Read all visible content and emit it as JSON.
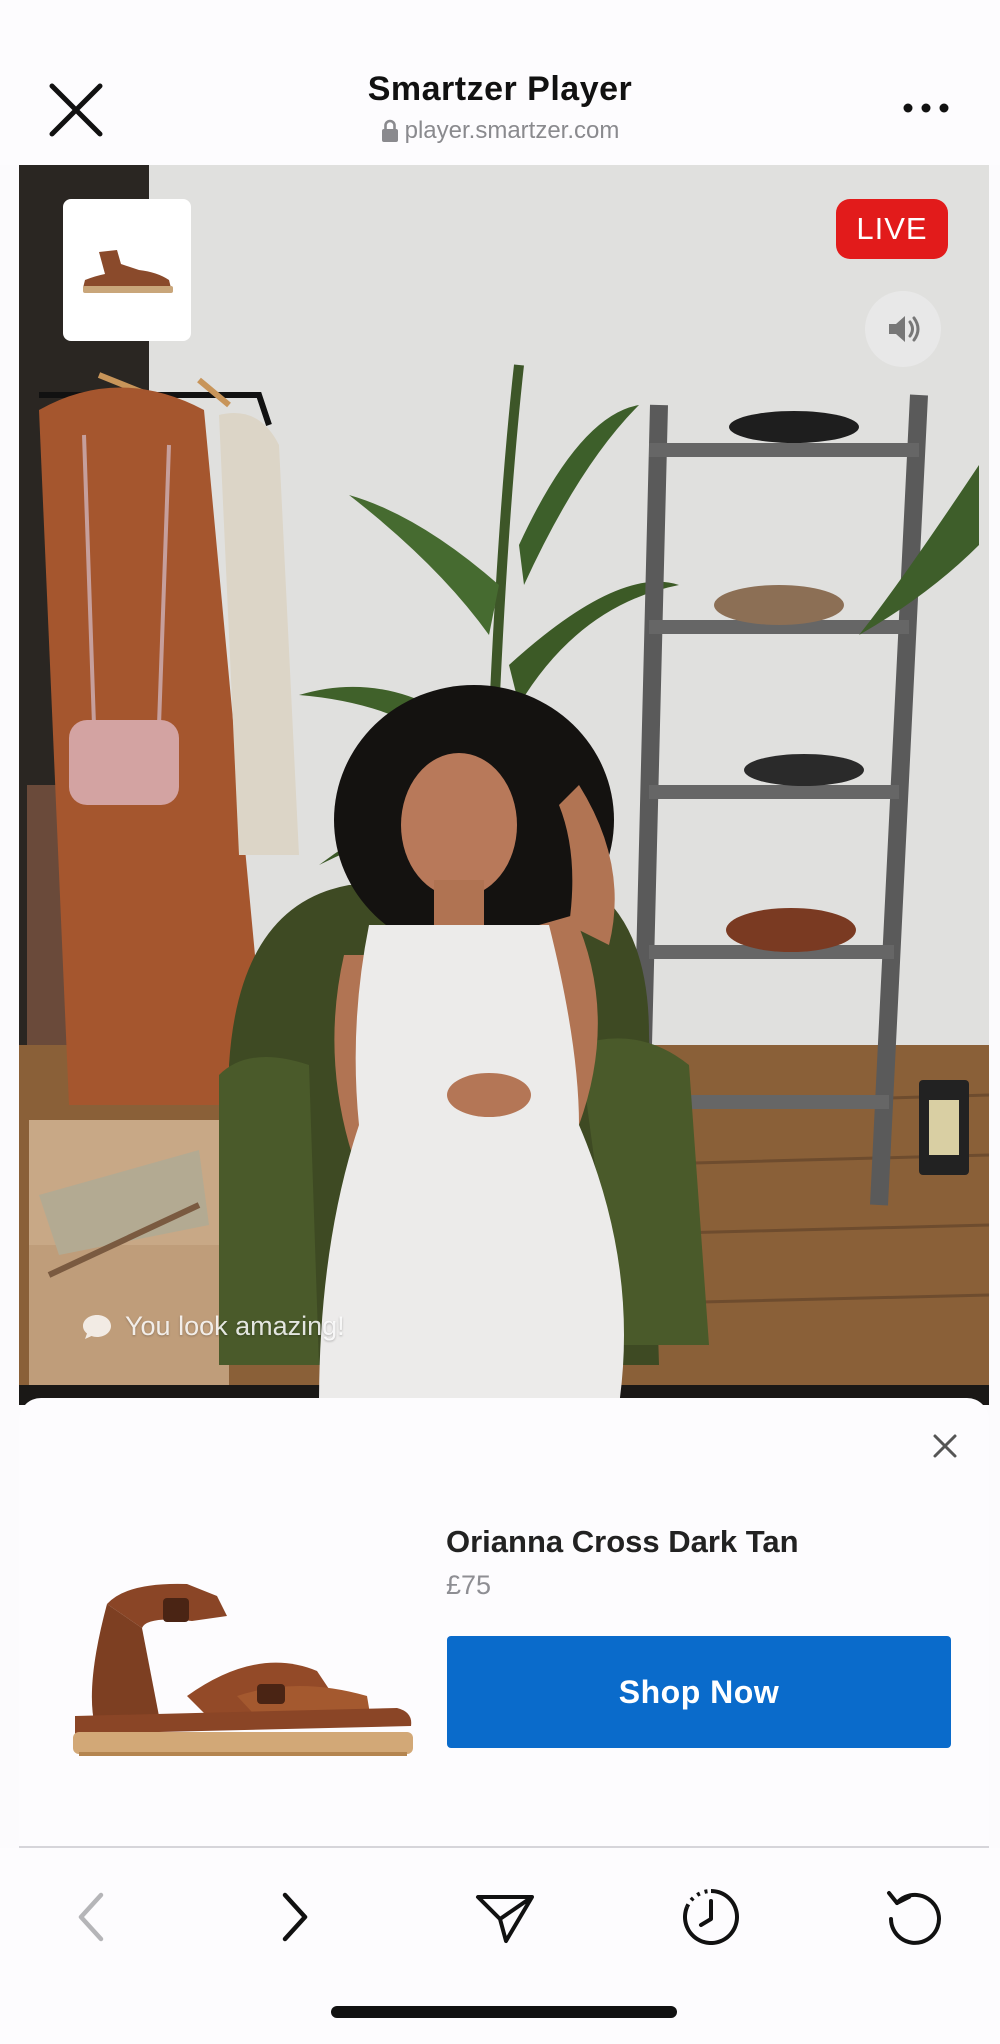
{
  "header": {
    "title": "Smartzer Player",
    "url": "player.smartzer.com",
    "close_icon": "close-icon",
    "more_icon": "more-horizontal-icon"
  },
  "video": {
    "live_label": "LIVE",
    "live_color": "#e21b1b",
    "comment": "You look amazing!",
    "mute_icon": "speaker-icon"
  },
  "product": {
    "name": "Orianna Cross Dark Tan",
    "price": "£75",
    "cta_label": "Shop Now",
    "cta_color": "#0a6bcb"
  },
  "toolbar": {
    "items": [
      "back-icon",
      "forward-icon",
      "share-icon",
      "history-icon",
      "reload-icon"
    ]
  }
}
